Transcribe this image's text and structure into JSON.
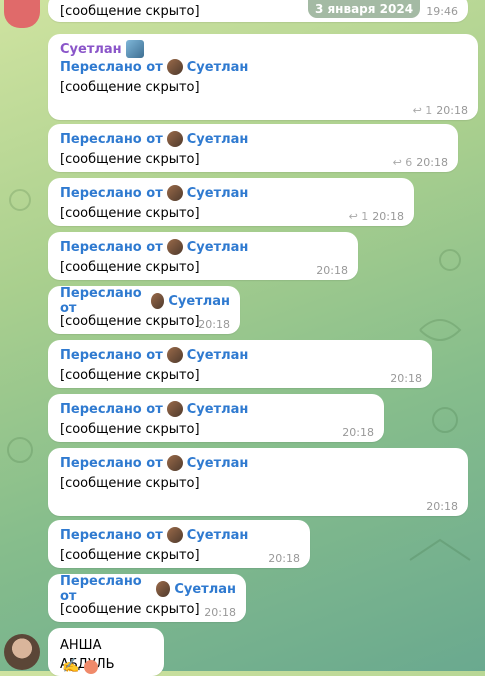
{
  "top": {
    "prev_tail": "[сообщение скрыто]",
    "date": "3 января 2024",
    "time": "19:46"
  },
  "messages": [
    {
      "sender": "Суетлан",
      "fwd_label": "Переслано от",
      "fwd_from": "Суетлан",
      "text": "[сообщение скрыто]",
      "replies": "1",
      "time": "20:18"
    },
    {
      "fwd_label": "Переслано от",
      "fwd_from": "Суетлан",
      "text": "[сообщение скрыто]",
      "replies": "6",
      "time": "20:18"
    },
    {
      "fwd_label": "Переслано от",
      "fwd_from": "Суетлан",
      "text": "[сообщение скрыто]",
      "replies": "1",
      "time": "20:18"
    },
    {
      "fwd_label": "Переслано от",
      "fwd_from": "Суетлан",
      "text": "[сообщение скрыто]",
      "time": "20:18"
    },
    {
      "fwd_label": "Переслано от",
      "fwd_from": "Суетлан",
      "text": "[сообщение скрыто]",
      "time": "20:18"
    },
    {
      "fwd_label": "Переслано от",
      "fwd_from": "Суетлан",
      "text": "[сообщение скрыто]",
      "time": "20:18"
    },
    {
      "fwd_label": "Переслано от",
      "fwd_from": "Суетлан",
      "text": "[сообщение скрыто]",
      "time": "20:18"
    },
    {
      "fwd_label": "Переслано от",
      "fwd_from": "Суетлан",
      "text": "[сообщение скрыто]",
      "time": "20:18"
    },
    {
      "fwd_label": "Переслано от",
      "fwd_from": "Суетлан",
      "text": "[сообщение скрыто]",
      "time": "20:18"
    },
    {
      "fwd_label": "Переслано от",
      "fwd_from": "Суетлан",
      "text": "[сообщение скрыто]",
      "time": "20:18"
    }
  ],
  "last": {
    "sender": "АНША АБДУЛЬ",
    "emoji": "✍️"
  },
  "colors": {
    "link": "#2f7ad0",
    "sender": "#8a55c9"
  }
}
